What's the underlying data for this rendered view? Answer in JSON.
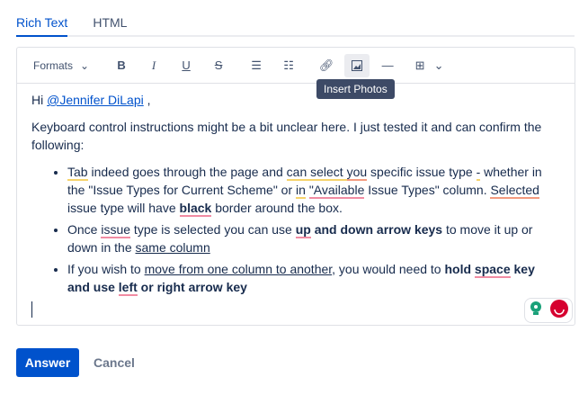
{
  "tabs": [
    "Rich Text",
    "HTML"
  ],
  "toolbar": {
    "formats": "Formats",
    "tooltip": "Insert Photos"
  },
  "content": {
    "greeting": "Hi ",
    "mention": "@Jennifer DiLapi",
    "greeting_end": " ,",
    "intro": "Keyboard control instructions might be a bit unclear here. I just tested it and can confirm the following:",
    "b1": [
      "Tab",
      " indeed goes through the page and ",
      "can select ",
      "you",
      " specific issue type ",
      "-",
      " whether in the \"Issue Types for Current Scheme\" or ",
      "in",
      " ",
      "\"Available",
      " Issue Types\" column. ",
      "Selected",
      " issue type will have ",
      "black",
      " border around the box."
    ],
    "b2": [
      "Once ",
      "issue",
      " type is selected you can use ",
      "up",
      " and down arrow keys",
      " to move it up or down in the ",
      "same column"
    ],
    "b3": [
      "If you wish to ",
      "move from one column to another",
      ", you would need to ",
      "hold ",
      "space",
      " key and use ",
      "left",
      " or right arrow key"
    ]
  },
  "actions": {
    "answer": "Answer",
    "cancel": "Cancel"
  }
}
